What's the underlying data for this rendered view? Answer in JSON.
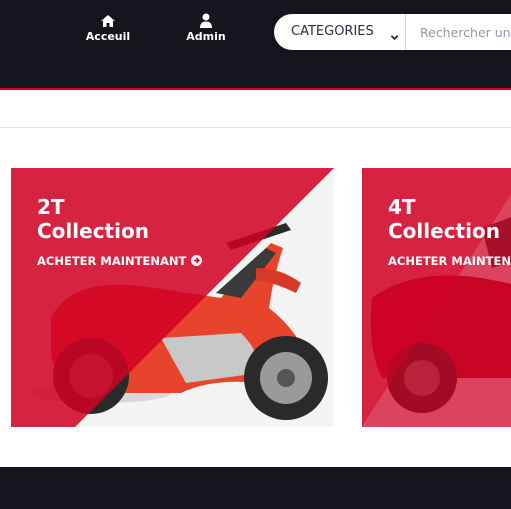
{
  "header": {
    "nav": [
      {
        "label": "Acceuil",
        "icon": "home-icon"
      },
      {
        "label": "Admin",
        "icon": "user-icon"
      }
    ],
    "search": {
      "category_label": "CATEGORIES",
      "placeholder": "Rechercher un"
    }
  },
  "collections": [
    {
      "title_line1": "2T",
      "title_line2": "Collection",
      "cta": "ACHETER MAINTENANT"
    },
    {
      "title_line1": "4T",
      "title_line2": "Collection",
      "cta": "ACHETER MAINTENANT"
    }
  ],
  "colors": {
    "header_bg": "#15161d",
    "accent": "#d10024",
    "card_red": "#d10024"
  }
}
